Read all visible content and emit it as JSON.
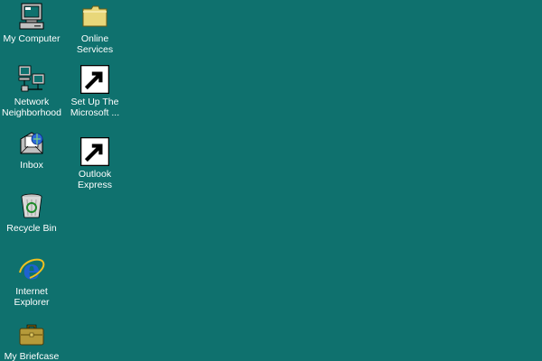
{
  "desktop": {
    "background_color": "#0f716e",
    "icons": [
      {
        "label": "My Computer",
        "icon": "my-computer-icon"
      },
      {
        "label": "Online\nServices",
        "icon": "folder-icon"
      },
      {
        "label": "Network\nNeighborhood",
        "icon": "network-neighborhood-icon"
      },
      {
        "label": "Set Up The\nMicrosoft ...",
        "icon": "msn-setup-icon"
      },
      {
        "label": "Inbox",
        "icon": "inbox-icon"
      },
      {
        "label": "Outlook\nExpress",
        "icon": "outlook-express-icon"
      },
      {
        "label": "Recycle Bin",
        "icon": "recycle-bin-icon"
      },
      {
        "label": "Internet\nExplorer",
        "icon": "internet-explorer-icon"
      },
      {
        "label": "My Briefcase",
        "icon": "briefcase-icon"
      }
    ]
  }
}
